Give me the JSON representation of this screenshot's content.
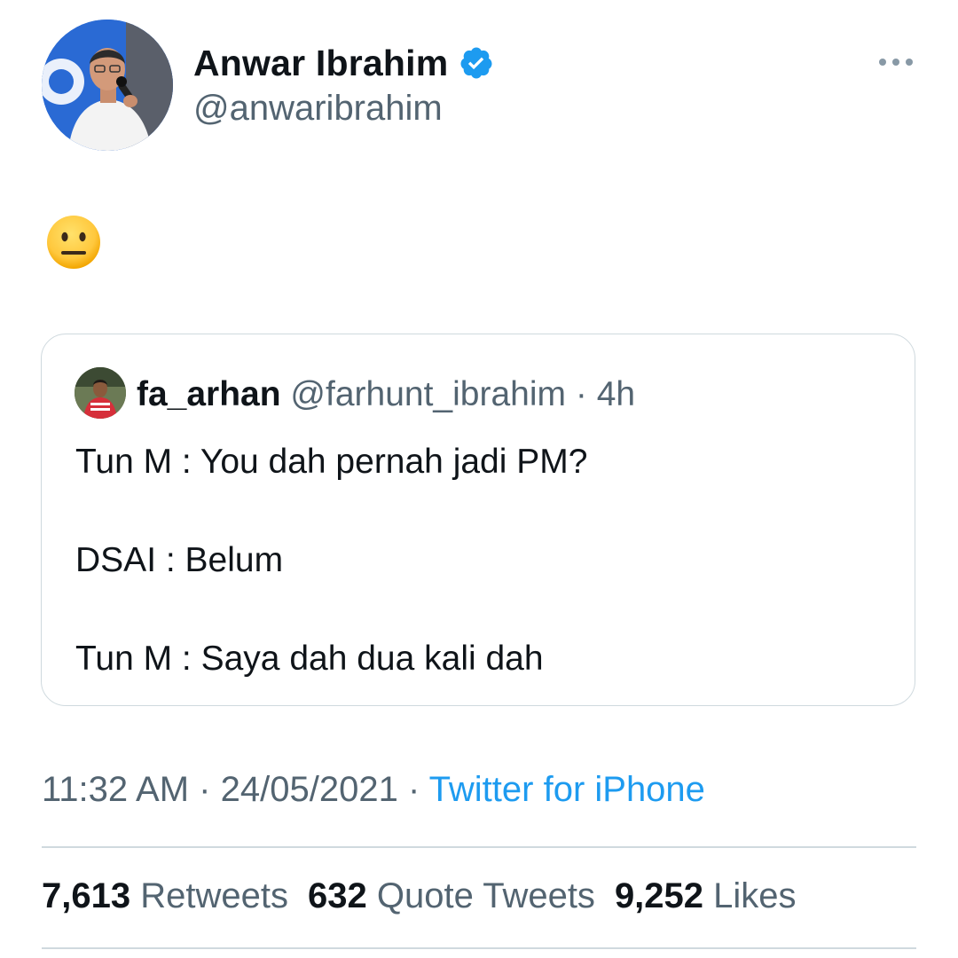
{
  "tweet": {
    "author": {
      "display_name": "Anwar Ibrahim",
      "handle": "@anwaribrahim",
      "verified": true
    },
    "text_emoji": "neutral-face-emoji",
    "quote": {
      "author_name": "fa_arhan",
      "author_handle": "@farhunt_ibrahim",
      "separator": "·",
      "time_ago": "4h",
      "lines": [
        "Tun M : You dah pernah jadi PM?",
        "DSAI : Belum",
        "Tun M : Saya dah dua kali dah"
      ]
    },
    "meta": {
      "time": "11:32 AM",
      "separator": "·",
      "date": "24/05/2021",
      "separator2": "·",
      "source": "Twitter for iPhone"
    },
    "stats": {
      "retweets_count": "7,613",
      "retweets_label": "Retweets",
      "quotes_count": "632",
      "quotes_label": "Quote Tweets",
      "likes_count": "9,252",
      "likes_label": "Likes"
    }
  },
  "colors": {
    "text_primary": "#0f1419",
    "text_secondary": "#536471",
    "link_blue": "#1d9bf0",
    "border": "#cfd9de",
    "emoji_yellow": "#ffc83d"
  }
}
